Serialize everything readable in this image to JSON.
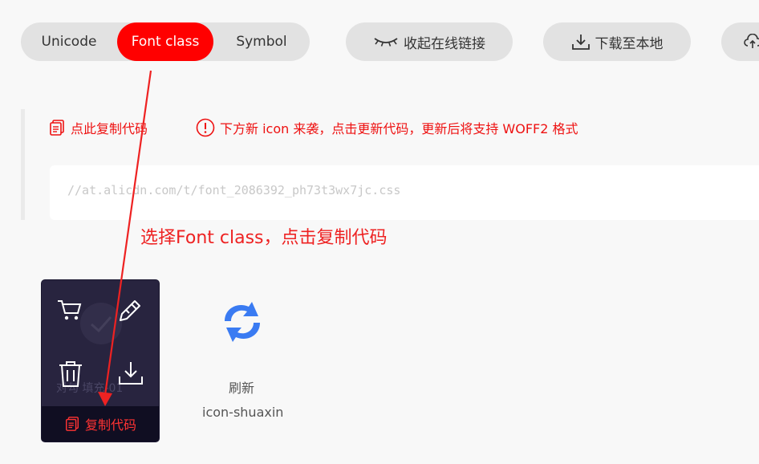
{
  "tabs": [
    {
      "label": "Unicode",
      "active": false
    },
    {
      "label": "Font class",
      "active": true
    },
    {
      "label": "Symbol",
      "active": false
    }
  ],
  "toolbar": {
    "collapse_label": "收起在线链接",
    "download_label": "下载至本地"
  },
  "notices": {
    "copy_label": "点此复制代码",
    "update_message": "下方新 icon 来袭，点击更新代码，更新后将支持 WOFF2 格式"
  },
  "code": {
    "url": "//at.alicdn.com/t/font_2086392_ph73t3wx7jc.css"
  },
  "annotation": {
    "text": "选择Font class，点击复制代码"
  },
  "icon_card": {
    "ghost_label": "对勾 填充-01",
    "copy_code_label": "复制代码"
  },
  "icon_item": {
    "name": "刷新",
    "code": "icon-shuaxin"
  },
  "colors": {
    "accent": "#ff0000",
    "pill_bg": "#e2e2e2",
    "card_bg": "#28243f",
    "refresh_icon": "#3a7bf2"
  }
}
